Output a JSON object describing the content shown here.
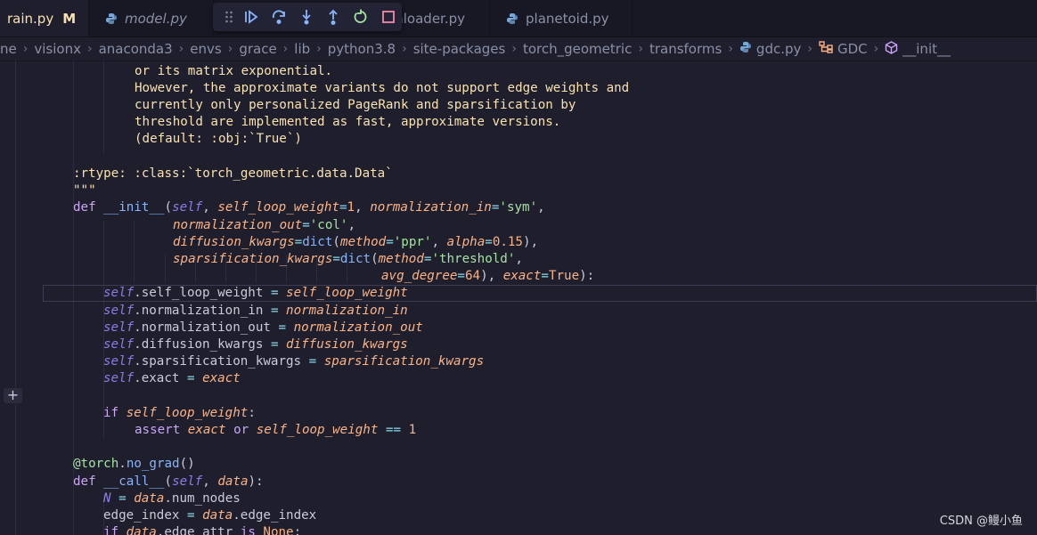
{
  "tabs": [
    {
      "label": "rain.py",
      "modified": "M",
      "active": true
    },
    {
      "label": "model.py",
      "active": false
    },
    {
      "label": "aloader.py",
      "active": false
    },
    {
      "label": "planetoid.py",
      "active": false
    }
  ],
  "debug_toolbar": {
    "buttons": [
      "drag-handle",
      "continue",
      "step-over",
      "step-into",
      "step-out",
      "restart",
      "stop"
    ]
  },
  "breadcrumb": [
    "ne",
    "visionx",
    "anaconda3",
    "envs",
    "grace",
    "lib",
    "python3.8",
    "site-packages",
    "torch_geometric",
    "transforms",
    "gdc.py",
    "GDC",
    "__init__"
  ],
  "code": {
    "l1": "or its matrix exponential.",
    "l2": "However, the approximate variants do not support edge weights and",
    "l3": "currently only personalized PageRank and sparsification by",
    "l4": "threshold are implemented as fast, approximate versions.",
    "l5": "(default: :obj:`True`)",
    "l6": ":rtype: :class:`torch_geometric.data.Data`",
    "l7": "\"\"\"",
    "def": "def",
    "init": "__init__",
    "self": "self",
    "p_slw": "self_loop_weight",
    "v1": "1",
    "p_nin": "normalization_in",
    "s_sym": "'sym'",
    "p_nout": "normalization_out",
    "s_col": "'col'",
    "p_dk": "diffusion_kwargs",
    "dict": "dict",
    "p_method": "method",
    "s_ppr": "'ppr'",
    "p_alpha": "alpha",
    "v015": "0.15",
    "p_sk": "sparsification_kwargs",
    "s_threshold": "'threshold'",
    "p_avg": "avg_degree",
    "v64": "64",
    "p_exact": "exact",
    "true": "True",
    "a_slw": "self_loop_weight",
    "a_nin": "normalization_in",
    "a_nout": "normalization_out",
    "a_dk": "diffusion_kwargs",
    "a_sk": "sparsification_kwargs",
    "a_exact": "exact",
    "if": "if",
    "assert": "assert",
    "or": "or",
    "eq": "==",
    "dec_at": "@",
    "dec_torch": "torch",
    "dec_fn": "no_grad",
    "call": "__call__",
    "data": "data",
    "N": "N",
    "num_nodes": "num_nodes",
    "edge_index": "edge_index",
    "edge_attr": "edge_attr",
    "is": "is",
    "none": "None"
  },
  "watermark": "CSDN @鳗小鱼"
}
